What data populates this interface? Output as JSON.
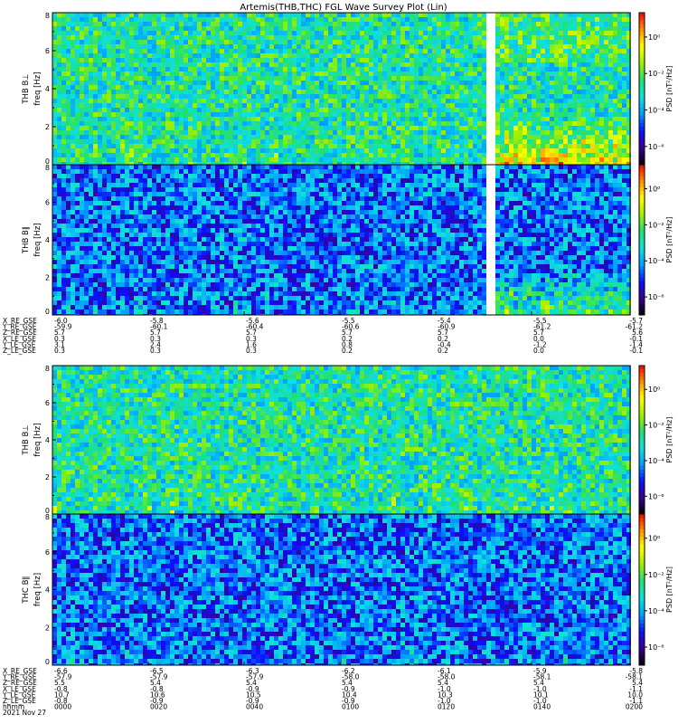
{
  "chart_data": {
    "type": "heatmap",
    "title": "Artemis(THB,THC) FGL Wave Survey Plot (Lin)",
    "colorbar": {
      "label": "PSD [nT²/Hz]",
      "tick_labels": [
        "10⁰",
        "10⁻²",
        "10⁻⁴",
        "10⁻⁶"
      ],
      "colors": [
        "#000000",
        "#3a0090",
        "#0a10ff",
        "#00a0ff",
        "#10e0e0",
        "#20e070",
        "#a0f000",
        "#ffff00",
        "#ff9000",
        "#ff0000"
      ]
    },
    "panels": [
      {
        "label": "THB B⊥",
        "ylabel": "freq [Hz]",
        "ylim": [
          0,
          8
        ],
        "yticks": [
          "0",
          "2",
          "4",
          "6",
          "8"
        ],
        "data_gap": true,
        "background": "green-cyan broadband noise; enhanced low-frequency activity (<2 Hz) after data gap"
      },
      {
        "label": "THB B∥",
        "ylabel": "freq [Hz]",
        "ylim": [
          0,
          8
        ],
        "yticks": [
          "0",
          "2",
          "4",
          "6",
          "8"
        ],
        "data_gap": true,
        "background": "blue noise; enhanced low-frequency bursts after data gap"
      },
      {
        "label": "THB B⊥",
        "ylabel": "freq [Hz]",
        "ylim": [
          0,
          8
        ],
        "yticks": [
          "0",
          "2",
          "4",
          "6",
          "8"
        ],
        "data_gap": false,
        "background": "green-cyan broadband noise"
      },
      {
        "label": "THC B∥",
        "ylabel": "freq [Hz]",
        "ylim": [
          0,
          8
        ],
        "yticks": [
          "0",
          "2",
          "4",
          "6",
          "8"
        ],
        "data_gap": false,
        "background": "blue noise"
      }
    ],
    "ephemeris_top": {
      "rows": [
        {
          "label": "X_RE_GSE",
          "values": [
            "-6.0",
            "-5.8",
            "-5.6",
            "-5.5",
            "-5.4",
            "-5.5",
            "-5.7"
          ]
        },
        {
          "label": "Y_RE_GSE",
          "values": [
            "-59.9",
            "-60.1",
            "-60.4",
            "-60.6",
            "-60.9",
            "-61.2",
            "-61.2"
          ]
        },
        {
          "label": "Z_RE_GSE",
          "values": [
            "5.7",
            "5.7",
            "5.7",
            "5.7",
            "5.7",
            "5.7",
            "5.6"
          ]
        },
        {
          "label": "X_LE_GSE",
          "values": [
            "0.3",
            "0.3",
            "0.3",
            "0.2",
            "0.2",
            "0.0",
            "-0.1"
          ]
        },
        {
          "label": "Y_LE_GSE",
          "values": [
            "3.1",
            "2.4",
            "1.6",
            "0.8",
            "-0.4",
            "-1.2",
            "-1.4"
          ]
        },
        {
          "label": "Z_LE_GSE",
          "values": [
            "0.3",
            "0.3",
            "0.3",
            "0.2",
            "0.2",
            "0.0",
            "-0.1"
          ]
        }
      ]
    },
    "ephemeris_bottom": {
      "rows": [
        {
          "label": "X_RE_GSE",
          "values": [
            "-6.6",
            "-6.5",
            "-6.3",
            "-6.2",
            "-6.1",
            "-5.9",
            "-5.8"
          ]
        },
        {
          "label": "Y_RE_GSE",
          "values": [
            "-57.9",
            "-57.9",
            "-57.9",
            "-58.0",
            "-58.0",
            "-58.1",
            "-58.1"
          ]
        },
        {
          "label": "Z_RE_GSE",
          "values": [
            "5.5",
            "5.4",
            "5.4",
            "5.4",
            "5.4",
            "5.4",
            "5.4"
          ]
        },
        {
          "label": "X_LE_GSE",
          "values": [
            "-0.8",
            "-0.8",
            "-0.9",
            "-0.9",
            "-1.0",
            "-1.0",
            "-1.1"
          ]
        },
        {
          "label": "Y_LE_GSE",
          "values": [
            "10.7",
            "10.6",
            "10.5",
            "10.4",
            "10.3",
            "10.1",
            "10.0"
          ]
        },
        {
          "label": "Z_LE_GSE",
          "values": [
            "-0.8",
            "-0.9",
            "-0.9",
            "-0.9",
            "-1.0",
            "-1.0",
            "-1.1"
          ]
        },
        {
          "label": "hhmm",
          "values": [
            "0000",
            "0020",
            "0040",
            "0100",
            "0120",
            "0140",
            "0200"
          ]
        }
      ],
      "date": "2021 Nov 27"
    }
  }
}
